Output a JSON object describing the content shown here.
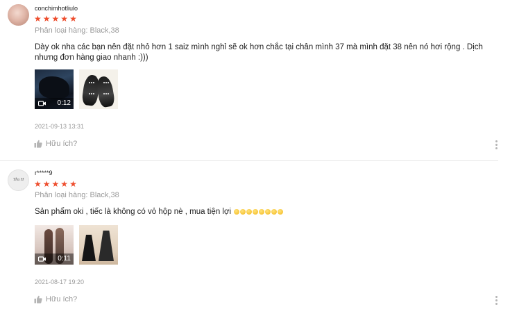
{
  "reviews": [
    {
      "username": "conchimhotliulo",
      "rating": 5,
      "variation": "Phân loại hàng: Black,38",
      "comment": "Dày ok nha các bạn nên đặt nhỏ hơn 1 saiz mình nghỉ sẽ ok hơn chắc tại chân mình 37 mà mình đặt 38 nên nó hơi rộng . Dịch nhưng đơn hàng giao nhanh :)))",
      "media": [
        {
          "type": "video",
          "duration": "0:12"
        },
        {
          "type": "image"
        }
      ],
      "timestamp": "2021-09-13 13:31",
      "helpful_label": "Hữu ích?"
    },
    {
      "username": "r*****9",
      "avatar_text": "Thu H",
      "rating": 5,
      "variation": "Phân loại hàng: Black,38",
      "comment": "Sản phẩm oki , tiếc là không có vỏ hộp nè , mua tiện lợi",
      "emoji_count": 8,
      "media": [
        {
          "type": "video",
          "duration": "0:11"
        },
        {
          "type": "image"
        }
      ],
      "timestamp": "2021-08-17 19:20",
      "helpful_label": "Hữu ích?"
    }
  ],
  "icons": {
    "star": "star-icon",
    "thumbs_up": "thumbs-up-icon",
    "video": "video-camera-icon",
    "more": "more-vertical-icon",
    "emoji": "smiley-emoji-icon"
  },
  "colors": {
    "star": "#ee4d2d",
    "muted_text": "#9a9a9a",
    "text": "#222222",
    "divider": "#e8e8e8"
  }
}
